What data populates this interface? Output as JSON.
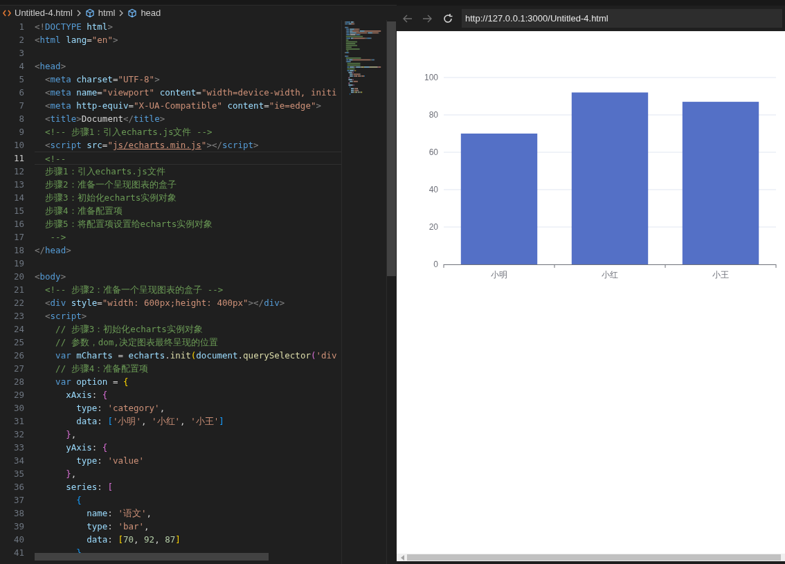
{
  "editor": {
    "breadcrumb": [
      {
        "kind": "file",
        "label": "Untitled-4.html"
      },
      {
        "kind": "element",
        "label": "html"
      },
      {
        "kind": "element",
        "label": "head"
      }
    ],
    "lines": [
      {
        "number": "1",
        "current": false,
        "tokens": [
          {
            "kind": "punct",
            "text": "<!"
          },
          {
            "kind": "tag",
            "text": "DOCTYPE"
          },
          {
            "kind": "attr",
            "text": " html"
          },
          {
            "kind": "punct",
            "text": ">"
          }
        ]
      },
      {
        "number": "2",
        "current": false,
        "tokens": [
          {
            "kind": "punct",
            "text": "<"
          },
          {
            "kind": "tag",
            "text": "html"
          },
          {
            "kind": "attr",
            "text": " lang"
          },
          {
            "kind": "plain",
            "text": "="
          },
          {
            "kind": "string",
            "text": "\"en\""
          },
          {
            "kind": "punct",
            "text": ">"
          }
        ]
      },
      {
        "number": "3",
        "current": false
      },
      {
        "number": "4",
        "current": false,
        "tokens": [
          {
            "kind": "punct",
            "text": "<"
          },
          {
            "kind": "tag",
            "text": "head"
          },
          {
            "kind": "punct",
            "text": ">"
          }
        ]
      },
      {
        "number": "5",
        "current": false,
        "tokens": [
          {
            "kind": "punct",
            "text": "  <"
          },
          {
            "kind": "tag",
            "text": "meta"
          },
          {
            "kind": "attr",
            "text": " charset"
          },
          {
            "kind": "plain",
            "text": "="
          },
          {
            "kind": "string",
            "text": "\"UTF-8\""
          },
          {
            "kind": "punct",
            "text": ">"
          }
        ]
      },
      {
        "number": "6",
        "current": false,
        "tokens": [
          {
            "kind": "punct",
            "text": "  <"
          },
          {
            "kind": "tag",
            "text": "meta"
          },
          {
            "kind": "attr",
            "text": " name"
          },
          {
            "kind": "plain",
            "text": "="
          },
          {
            "kind": "string",
            "text": "\"viewport\""
          },
          {
            "kind": "attr",
            "text": " content"
          },
          {
            "kind": "plain",
            "text": "="
          },
          {
            "kind": "string",
            "text": "\"width=device-width, initi"
          }
        ]
      },
      {
        "number": "7",
        "current": false,
        "tokens": [
          {
            "kind": "punct",
            "text": "  <"
          },
          {
            "kind": "tag",
            "text": "meta"
          },
          {
            "kind": "attr",
            "text": " http-equiv"
          },
          {
            "kind": "plain",
            "text": "="
          },
          {
            "kind": "string",
            "text": "\"X-UA-Compatible\""
          },
          {
            "kind": "attr",
            "text": " content"
          },
          {
            "kind": "plain",
            "text": "="
          },
          {
            "kind": "string",
            "text": "\"ie=edge\""
          },
          {
            "kind": "punct",
            "text": ">"
          }
        ]
      },
      {
        "number": "8",
        "current": false,
        "tokens": [
          {
            "kind": "punct",
            "text": "  <"
          },
          {
            "kind": "tag",
            "text": "title"
          },
          {
            "kind": "punct",
            "text": ">"
          },
          {
            "kind": "plain",
            "text": "Document"
          },
          {
            "kind": "punct",
            "text": "</"
          },
          {
            "kind": "tag",
            "text": "title"
          },
          {
            "kind": "punct",
            "text": ">"
          }
        ]
      },
      {
        "number": "9",
        "current": false,
        "tokens": [
          {
            "kind": "comment",
            "text": "  <!-- 步骤1：引入echarts.js文件 -->"
          }
        ]
      },
      {
        "number": "10",
        "current": false,
        "tokens": [
          {
            "kind": "punct",
            "text": "  <"
          },
          {
            "kind": "tag",
            "text": "script"
          },
          {
            "kind": "attr",
            "text": " src"
          },
          {
            "kind": "plain",
            "text": "="
          },
          {
            "kind": "string",
            "text": "\""
          },
          {
            "kind": "link",
            "text": "js/echarts.min.js"
          },
          {
            "kind": "string",
            "text": "\""
          },
          {
            "kind": "punct",
            "text": "></"
          },
          {
            "kind": "tag",
            "text": "script"
          },
          {
            "kind": "punct",
            "text": ">"
          }
        ]
      },
      {
        "number": "11",
        "current": true,
        "tokens": [
          {
            "kind": "comment",
            "text": "  <!--"
          }
        ]
      },
      {
        "number": "12",
        "current": false,
        "tokens": [
          {
            "kind": "comment",
            "text": "  步骤1：引入echarts.js文件"
          }
        ]
      },
      {
        "number": "13",
        "current": false,
        "tokens": [
          {
            "kind": "comment",
            "text": "  步骤2：准备一个呈现图表的盒子"
          }
        ]
      },
      {
        "number": "14",
        "current": false,
        "tokens": [
          {
            "kind": "comment",
            "text": "  步骤3：初始化echarts实例对象"
          }
        ]
      },
      {
        "number": "15",
        "current": false,
        "tokens": [
          {
            "kind": "comment",
            "text": "  步骤4：准备配置项"
          }
        ]
      },
      {
        "number": "16",
        "current": false,
        "tokens": [
          {
            "kind": "comment",
            "text": "  步骤5：将配置项设置给echarts实例对象"
          }
        ]
      },
      {
        "number": "17",
        "current": false,
        "tokens": [
          {
            "kind": "comment",
            "text": "   -->"
          }
        ]
      },
      {
        "number": "18",
        "current": false,
        "tokens": [
          {
            "kind": "punct",
            "text": "</"
          },
          {
            "kind": "tag",
            "text": "head"
          },
          {
            "kind": "punct",
            "text": ">"
          }
        ]
      },
      {
        "number": "19",
        "current": false
      },
      {
        "number": "20",
        "current": false,
        "tokens": [
          {
            "kind": "punct",
            "text": "<"
          },
          {
            "kind": "tag",
            "text": "body"
          },
          {
            "kind": "punct",
            "text": ">"
          }
        ]
      },
      {
        "number": "21",
        "current": false,
        "tokens": [
          {
            "kind": "comment",
            "text": "  <!-- 步骤2：准备一个呈现图表的盒子 -->"
          }
        ]
      },
      {
        "number": "22",
        "current": false,
        "tokens": [
          {
            "kind": "punct",
            "text": "  <"
          },
          {
            "kind": "tag",
            "text": "div"
          },
          {
            "kind": "attr",
            "text": " style"
          },
          {
            "kind": "plain",
            "text": "="
          },
          {
            "kind": "string",
            "text": "\"width: 600px;height: 400px\""
          },
          {
            "kind": "punct",
            "text": "></"
          },
          {
            "kind": "tag",
            "text": "div"
          },
          {
            "kind": "punct",
            "text": ">"
          }
        ]
      },
      {
        "number": "23",
        "current": false,
        "tokens": [
          {
            "kind": "punct",
            "text": "  <"
          },
          {
            "kind": "tag",
            "text": "script"
          },
          {
            "kind": "punct",
            "text": ">"
          }
        ]
      },
      {
        "number": "24",
        "current": false,
        "tokens": [
          {
            "kind": "comment",
            "text": "    // 步骤3：初始化echarts实例对象"
          }
        ]
      },
      {
        "number": "25",
        "current": false,
        "tokens": [
          {
            "kind": "comment",
            "text": "    // 参数，dom,决定图表最终呈现的位置"
          }
        ]
      },
      {
        "number": "26",
        "current": false,
        "tokens": [
          {
            "kind": "keyword",
            "text": "    var"
          },
          {
            "kind": "variable",
            "text": " mCharts"
          },
          {
            "kind": "plain",
            "text": " = "
          },
          {
            "kind": "variable",
            "text": "echarts"
          },
          {
            "kind": "plain",
            "text": "."
          },
          {
            "kind": "function",
            "text": "init"
          },
          {
            "kind": "bracket1",
            "text": "("
          },
          {
            "kind": "variable",
            "text": "document"
          },
          {
            "kind": "plain",
            "text": "."
          },
          {
            "kind": "function",
            "text": "querySelector"
          },
          {
            "kind": "bracket2",
            "text": "("
          },
          {
            "kind": "string",
            "text": "'div"
          }
        ]
      },
      {
        "number": "27",
        "current": false,
        "tokens": [
          {
            "kind": "comment",
            "text": "    // 步骤4：准备配置项"
          }
        ]
      },
      {
        "number": "28",
        "current": false,
        "tokens": [
          {
            "kind": "keyword",
            "text": "    var"
          },
          {
            "kind": "variable",
            "text": " option"
          },
          {
            "kind": "plain",
            "text": " = "
          },
          {
            "kind": "bracket1",
            "text": "{"
          }
        ]
      },
      {
        "number": "29",
        "current": false,
        "tokens": [
          {
            "kind": "variable",
            "text": "      xAxis"
          },
          {
            "kind": "plain",
            "text": ": "
          },
          {
            "kind": "bracket2",
            "text": "{"
          }
        ]
      },
      {
        "number": "30",
        "current": false,
        "tokens": [
          {
            "kind": "variable",
            "text": "        type"
          },
          {
            "kind": "plain",
            "text": ": "
          },
          {
            "kind": "string",
            "text": "'category'"
          },
          {
            "kind": "plain",
            "text": ","
          }
        ]
      },
      {
        "number": "31",
        "current": false,
        "tokens": [
          {
            "kind": "variable",
            "text": "        data"
          },
          {
            "kind": "plain",
            "text": ": "
          },
          {
            "kind": "bracket3",
            "text": "["
          },
          {
            "kind": "string",
            "text": "'小明'"
          },
          {
            "kind": "plain",
            "text": ", "
          },
          {
            "kind": "string",
            "text": "'小红'"
          },
          {
            "kind": "plain",
            "text": ", "
          },
          {
            "kind": "string",
            "text": "'小王'"
          },
          {
            "kind": "bracket3",
            "text": "]"
          }
        ]
      },
      {
        "number": "32",
        "current": false,
        "tokens": [
          {
            "kind": "bracket2",
            "text": "      }"
          },
          {
            "kind": "plain",
            "text": ","
          }
        ]
      },
      {
        "number": "33",
        "current": false,
        "tokens": [
          {
            "kind": "variable",
            "text": "      yAxis"
          },
          {
            "kind": "plain",
            "text": ": "
          },
          {
            "kind": "bracket2",
            "text": "{"
          }
        ]
      },
      {
        "number": "34",
        "current": false,
        "tokens": [
          {
            "kind": "variable",
            "text": "        type"
          },
          {
            "kind": "plain",
            "text": ": "
          },
          {
            "kind": "string",
            "text": "'value'"
          }
        ]
      },
      {
        "number": "35",
        "current": false,
        "tokens": [
          {
            "kind": "bracket2",
            "text": "      }"
          },
          {
            "kind": "plain",
            "text": ","
          }
        ]
      },
      {
        "number": "36",
        "current": false,
        "tokens": [
          {
            "kind": "variable",
            "text": "      series"
          },
          {
            "kind": "plain",
            "text": ": "
          },
          {
            "kind": "bracket2",
            "text": "["
          }
        ]
      },
      {
        "number": "37",
        "current": false,
        "tokens": [
          {
            "kind": "bracket3",
            "text": "        {"
          }
        ]
      },
      {
        "number": "38",
        "current": false,
        "tokens": [
          {
            "kind": "variable",
            "text": "          name"
          },
          {
            "kind": "plain",
            "text": ": "
          },
          {
            "kind": "string",
            "text": "'语文'"
          },
          {
            "kind": "plain",
            "text": ","
          }
        ]
      },
      {
        "number": "39",
        "current": false,
        "tokens": [
          {
            "kind": "variable",
            "text": "          type"
          },
          {
            "kind": "plain",
            "text": ": "
          },
          {
            "kind": "string",
            "text": "'bar'"
          },
          {
            "kind": "plain",
            "text": ","
          }
        ]
      },
      {
        "number": "40",
        "current": false,
        "tokens": [
          {
            "kind": "variable",
            "text": "          data"
          },
          {
            "kind": "plain",
            "text": ": "
          },
          {
            "kind": "bracket1",
            "text": "["
          },
          {
            "kind": "number",
            "text": "70"
          },
          {
            "kind": "plain",
            "text": ", "
          },
          {
            "kind": "number",
            "text": "92"
          },
          {
            "kind": "plain",
            "text": ", "
          },
          {
            "kind": "number",
            "text": "87"
          },
          {
            "kind": "bracket1",
            "text": "]"
          }
        ]
      },
      {
        "number": "41",
        "current": false,
        "tokens": [
          {
            "kind": "bracket3",
            "text": "        }"
          }
        ]
      }
    ]
  },
  "browser": {
    "back": {
      "disabled": true
    },
    "forward": {
      "disabled": true
    },
    "address": "http://127.0.0.1:3000/Untitled-4.html",
    "chart": {
      "chart_data": {
        "type": "bar",
        "categories": [
          "小明",
          "小红",
          "小王"
        ],
        "series": [
          {
            "color": "#5470c6",
            "values": [
              70,
              92,
              87
            ]
          }
        ],
        "grid": true,
        "ylim": [
          0,
          100
        ],
        "yticks": [
          0,
          20,
          40,
          60,
          80,
          100
        ]
      }
    }
  }
}
